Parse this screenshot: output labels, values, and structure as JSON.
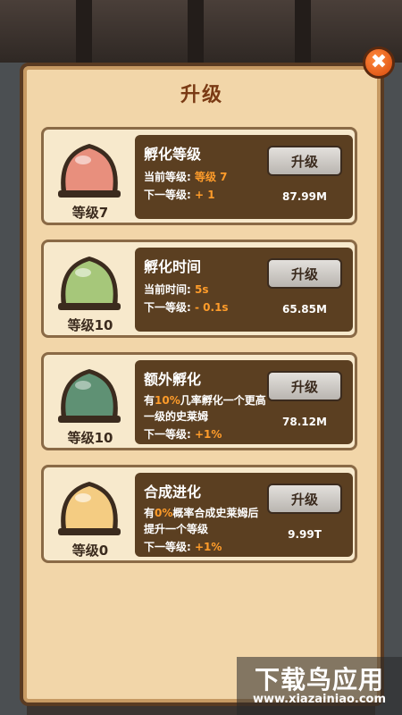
{
  "title": "升级",
  "upgrades": [
    {
      "name": "孵化等级",
      "level_label": "等级7",
      "line1_prefix": "当前等级:",
      "line1_value": "等级 7",
      "line2_prefix": "下一等级:",
      "line2_value": "+ 1",
      "button_label": "升级",
      "cost": "87.99M",
      "slime_color": "#e88f7d"
    },
    {
      "name": "孵化时间",
      "level_label": "等级10",
      "line1_prefix": "当前时间:",
      "line1_value": "5s",
      "line2_prefix": "下一等级:",
      "line2_value": "- 0.1s",
      "button_label": "升级",
      "cost": "65.85M",
      "slime_color": "#a6c77a"
    },
    {
      "name": "额外孵化",
      "level_label": "等级10",
      "desc1_prefix": "有",
      "desc1_accent": "10%",
      "desc1_suffix": "几率孵化一个更高",
      "desc2": "一级的史莱姆",
      "line2_prefix": "下一等级:",
      "line2_value": "+1%",
      "button_label": "升级",
      "cost": "78.12M",
      "slime_color": "#5f9174"
    },
    {
      "name": "合成进化",
      "level_label": "等级0",
      "desc1_prefix": "有",
      "desc1_accent": "0%",
      "desc1_suffix": "概率合成史莱姆后",
      "desc2": "提升一个等级",
      "line2_prefix": "下一等级:",
      "line2_value": "+1%",
      "button_label": "升级",
      "cost": "9.99T",
      "slime_color": "#f4cc82"
    }
  ],
  "watermark": {
    "main": "下载鸟应用",
    "sub": "www.xiazainiao.com"
  }
}
